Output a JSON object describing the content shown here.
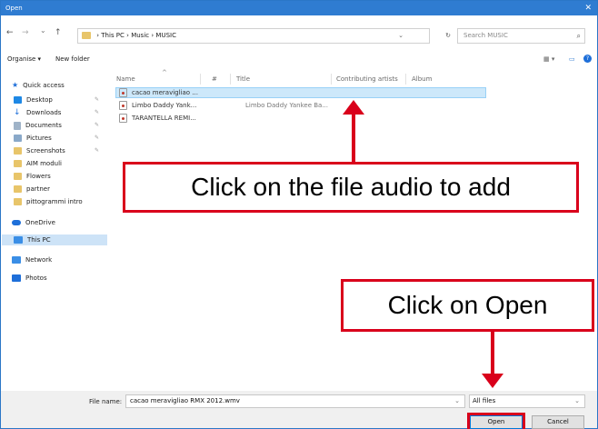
{
  "window": {
    "title": "Open",
    "close_glyph": "✕"
  },
  "nav_buttons": {
    "back": "←",
    "forward": "→",
    "recent": "⌄",
    "up": "↑"
  },
  "address": {
    "crumbs": [
      "This PC",
      "Music",
      "MUSIC"
    ],
    "separator": "›",
    "refresh": "↻",
    "dropdown": "⌄"
  },
  "search": {
    "placeholder": "Search MUSIC",
    "icon": "search-icon"
  },
  "toolbar": {
    "organise": "Organise ▾",
    "new_folder": "New folder",
    "view_icon": "▦ ▾",
    "pane_icon": "▭",
    "help_icon": "❓"
  },
  "sidebar": {
    "quick_access": "Quick access",
    "items": [
      {
        "label": "Desktop",
        "color": "#1e88e5",
        "pinned": true
      },
      {
        "label": "Downloads",
        "color": "#1e6fd9",
        "pinned": true
      },
      {
        "label": "Documents",
        "color": "#9fb3c8",
        "pinned": true
      },
      {
        "label": "Pictures",
        "color": "#8aa9c9",
        "pinned": true
      },
      {
        "label": "Screenshots",
        "color": "#e8c56a",
        "pinned": true
      },
      {
        "label": "AIM moduli",
        "color": "#e8c56a",
        "pinned": false
      },
      {
        "label": "Flowers",
        "color": "#e8c56a",
        "pinned": false
      },
      {
        "label": "partner",
        "color": "#e8c56a",
        "pinned": false
      },
      {
        "label": "pittogrammi intro",
        "color": "#e8c56a",
        "pinned": false
      }
    ],
    "onedrive": "OneDrive",
    "this_pc": "This PC",
    "network": "Network",
    "photos": "Photos",
    "pin_glyph": "📌"
  },
  "columns": [
    "Name",
    "#",
    "Title",
    "Contributing artists",
    "Album"
  ],
  "files": [
    {
      "name": "cacao meravigliao ...",
      "title": "",
      "artists": ""
    },
    {
      "name": "Limbo  Daddy Yank...",
      "title": "Limbo  Daddy Yankee  Ba...",
      "artists": ""
    },
    {
      "name": "TARANTELLA REMI...",
      "title": "",
      "artists": ""
    }
  ],
  "annotations": {
    "add": "Click on the file audio to add",
    "open": "Click on Open"
  },
  "footer": {
    "file_name_label": "File name:",
    "file_name_value": "cacao meravigliao RMX 2012.wmv",
    "file_type": "All files",
    "open_button": "Open",
    "cancel_button": "Cancel",
    "chevron": "⌄"
  },
  "colors": {
    "titlebar": "#2f7cd1",
    "annotation_red": "#d9001b",
    "selection": "#cde8fa"
  }
}
